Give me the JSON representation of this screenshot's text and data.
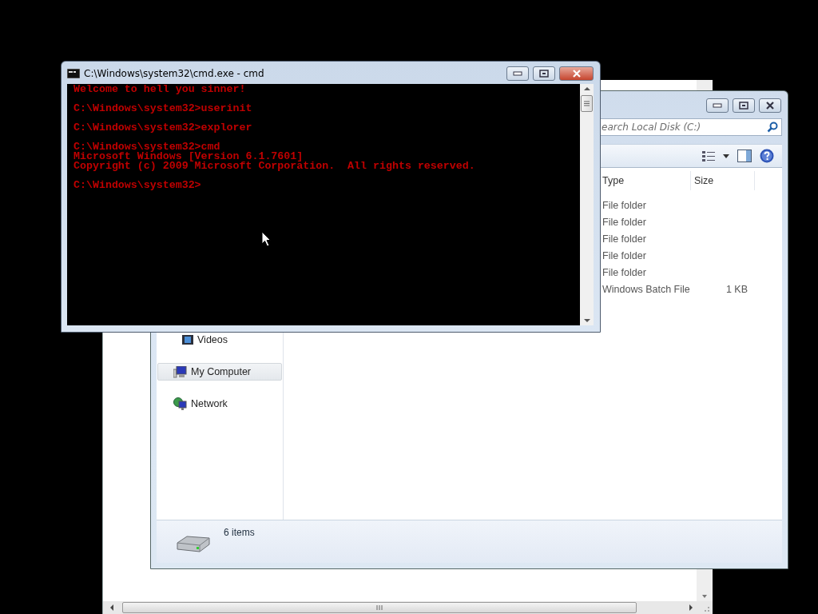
{
  "cmd_window": {
    "title": "C:\\Windows\\system32\\cmd.exe - cmd",
    "console": {
      "blocks": [
        [
          "Welcome to hell you sinner!"
        ],
        [
          "C:\\Windows\\system32>userinit"
        ],
        [
          "C:\\Windows\\system32>explorer"
        ],
        [
          "C:\\Windows\\system32>cmd",
          "Microsoft Windows [Version 6.1.7601]",
          "Copyright (c) 2009 Microsoft Corporation.  All rights reserved."
        ],
        [
          "C:\\Windows\\system32>"
        ]
      ]
    }
  },
  "explorer_window": {
    "search": {
      "placeholder": "earch Local Disk (C:)"
    },
    "columns": [
      "Type",
      "Size"
    ],
    "rows": [
      {
        "type": "File folder"
      },
      {
        "type": "File folder"
      },
      {
        "type": "File folder"
      },
      {
        "type": "File folder"
      },
      {
        "type": "File folder"
      },
      {
        "type": "Windows Batch File",
        "size": "1 KB"
      }
    ],
    "nav_items": [
      {
        "label": "Videos",
        "kind": "videos",
        "selected": false
      },
      {
        "label": "My Computer",
        "kind": "computer",
        "selected": true
      },
      {
        "label": "Network",
        "kind": "network",
        "selected": false
      }
    ],
    "status_bar": {
      "item_count": "6 items"
    }
  }
}
